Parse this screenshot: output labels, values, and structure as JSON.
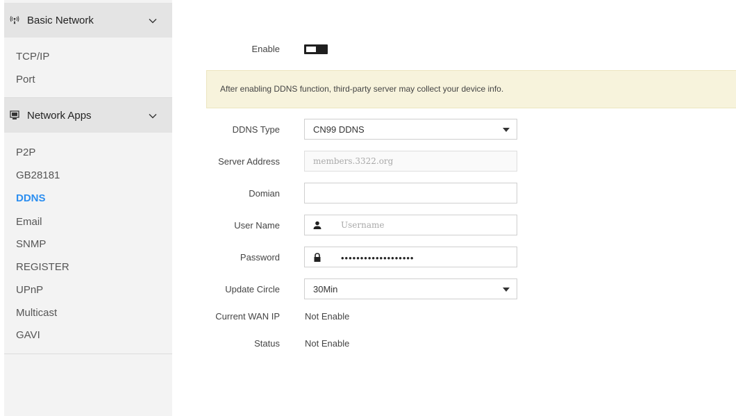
{
  "sidebar": {
    "groups": [
      {
        "label": "Basic Network",
        "icon": "wireless-antenna-icon",
        "items": [
          "TCP/IP",
          "Port"
        ]
      },
      {
        "label": "Network Apps",
        "icon": "monitor-icon",
        "items": [
          "P2P",
          "GB28181",
          "DDNS",
          "Email",
          "SNMP",
          "REGISTER",
          "UPnP",
          "Multicast",
          "GAVI"
        ]
      }
    ],
    "active_item": "DDNS"
  },
  "form": {
    "enable_label": "Enable",
    "enable_state": "off",
    "notice": "After enabling DDNS function, third-party server may collect your device info.",
    "ddns_type_label": "DDNS Type",
    "ddns_type_value": "CN99 DDNS",
    "server_address_label": "Server Address",
    "server_address_placeholder": "members.3322.org",
    "domain_label": "Domian",
    "domain_value": "",
    "username_label": "User Name",
    "username_placeholder": "Username",
    "password_label": "Password",
    "password_masked": "•••••••••••••••••••",
    "update_circle_label": "Update Circle",
    "update_circle_value": "30Min",
    "wan_ip_label": "Current WAN IP",
    "wan_ip_value": "Not Enable",
    "status_label": "Status",
    "status_value": "Not Enable"
  },
  "colors": {
    "accent": "#2b8ef0",
    "notice_bg": "#f7f3dc",
    "sidebar_bg": "#f3f3f3",
    "group_header_bg": "#e4e4e4"
  }
}
